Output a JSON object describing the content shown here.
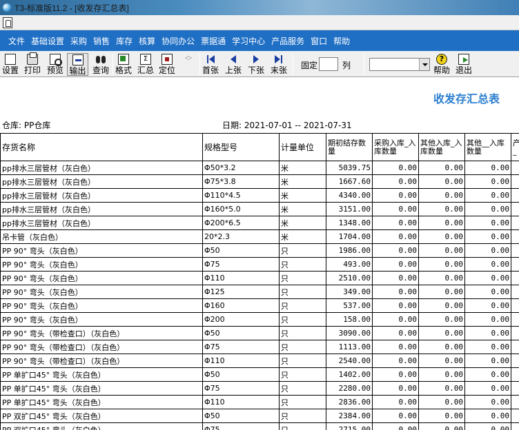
{
  "window": {
    "title": "T3-标准版11.2 - [收发存汇总表]"
  },
  "menu": [
    "文件",
    "基础设置",
    "采购",
    "销售",
    "库存",
    "核算",
    "协同办公",
    "票据通",
    "学习中心",
    "产品服务",
    "窗口",
    "帮助"
  ],
  "toolbar": {
    "setup": "设置",
    "print": "打印",
    "preview": "预览",
    "output": "输出",
    "query": "查询",
    "format": "格式",
    "summary": "汇总",
    "locate": "定位",
    "first": "首张",
    "prev": "上张",
    "next": "下张",
    "last": "末张",
    "fix_label": "固定",
    "fix_value": "",
    "col_label": "列",
    "help": "帮助",
    "exit": "退出"
  },
  "report": {
    "title": "收发存汇总表",
    "warehouse": "仓库: PP仓库",
    "date_range": "日期: 2021-07-01 -- 2021-07-31",
    "headers": [
      "存货名称",
      "规格型号",
      "计量单位",
      "期初结存数量",
      "采购入库_入库数量",
      "其他入库_入库数量",
      "其他__入库数量",
      "产_"
    ],
    "rows": [
      [
        "pp排水三层管材（灰白色）",
        "Φ50*3.2",
        "米",
        "5039.75",
        "0.00",
        "0.00",
        "0.00"
      ],
      [
        "pp排水三层管材（灰白色）",
        "Φ75*3.8",
        "米",
        "1667.60",
        "0.00",
        "0.00",
        "0.00"
      ],
      [
        "pp排水三层管材（灰白色）",
        "Φ110*4.5",
        "米",
        "4340.00",
        "0.00",
        "0.00",
        "0.00"
      ],
      [
        "pp排水三层管材（灰白色）",
        "Φ160*5.0",
        "米",
        "3151.00",
        "0.00",
        "0.00",
        "0.00"
      ],
      [
        "pp排水三层管材（灰白色）",
        "Φ200*6.5",
        "米",
        "1348.00",
        "0.00",
        "0.00",
        "0.00"
      ],
      [
        "吊卡管（灰白色）",
        "20*2.3",
        "米",
        "1704.00",
        "0.00",
        "0.00",
        "0.00"
      ],
      [
        "PP 90° 弯头（灰白色）",
        "Φ50",
        "只",
        "1986.00",
        "0.00",
        "0.00",
        "0.00"
      ],
      [
        "PP 90° 弯头（灰白色）",
        "Φ75",
        "只",
        "493.00",
        "0.00",
        "0.00",
        "0.00"
      ],
      [
        "PP 90° 弯头（灰白色）",
        "Φ110",
        "只",
        "2510.00",
        "0.00",
        "0.00",
        "0.00"
      ],
      [
        "PP 90° 弯头（灰白色）",
        "Φ125",
        "只",
        "349.00",
        "0.00",
        "0.00",
        "0.00"
      ],
      [
        "PP 90° 弯头（灰白色）",
        "Φ160",
        "只",
        "537.00",
        "0.00",
        "0.00",
        "0.00"
      ],
      [
        "PP 90° 弯头（灰白色）",
        "Φ200",
        "只",
        "158.00",
        "0.00",
        "0.00",
        "0.00"
      ],
      [
        "PP 90° 弯头（带检查口）（灰白色）",
        "Φ50",
        "只",
        "3090.00",
        "0.00",
        "0.00",
        "0.00"
      ],
      [
        "PP 90° 弯头（带检查口）（灰白色）",
        "Φ75",
        "只",
        "1113.00",
        "0.00",
        "0.00",
        "0.00"
      ],
      [
        "PP 90° 弯头（带检查口）（灰白色）",
        "Φ110",
        "只",
        "2540.00",
        "0.00",
        "0.00",
        "0.00"
      ],
      [
        "PP 单扩口45° 弯头（灰白色）",
        "Φ50",
        "只",
        "1402.00",
        "0.00",
        "0.00",
        "0.00"
      ],
      [
        "PP 单扩口45° 弯头（灰白色）",
        "Φ75",
        "只",
        "2280.00",
        "0.00",
        "0.00",
        "0.00"
      ],
      [
        "PP 单扩口45° 弯头（灰白色）",
        "Φ110",
        "只",
        "2836.00",
        "0.00",
        "0.00",
        "0.00"
      ],
      [
        "PP 双扩口45° 弯头（灰白色）",
        "Φ50",
        "只",
        "2384.00",
        "0.00",
        "0.00",
        "0.00"
      ],
      [
        "PP 双扩口45° 弯头（灰白色）",
        "Φ75",
        "只",
        "2715.00",
        "0.00",
        "0.00",
        "0.00"
      ]
    ]
  }
}
